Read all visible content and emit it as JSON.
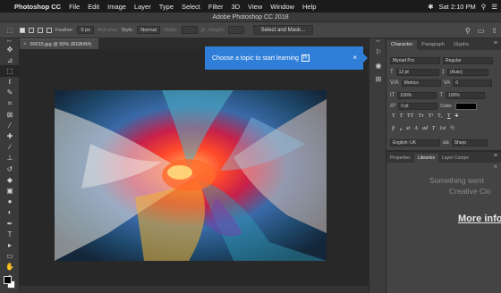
{
  "menubar": {
    "app_name": "Photoshop CC",
    "items": [
      "File",
      "Edit",
      "Image",
      "Layer",
      "Type",
      "Select",
      "Filter",
      "3D",
      "View",
      "Window",
      "Help"
    ],
    "clock": "Sat 2:10 PM"
  },
  "window": {
    "title": "Adobe Photoshop CC 2018"
  },
  "options_bar": {
    "feather_label": "Feather:",
    "feather_value": "0 px",
    "anti_alias_label": "Anti-alias",
    "style_label": "Style:",
    "style_value": "Normal",
    "width_label": "Width:",
    "height_label": "Height:",
    "select_mask_label": "Select and Mask..."
  },
  "document": {
    "tab_label": "00015.jpg @ 50% (RGB/8#)",
    "close_glyph": "×"
  },
  "learn_tooltip": {
    "text": "Choose a topic to start learning",
    "badge": "Pr",
    "close_glyph": "×"
  },
  "character_panel": {
    "tabs": [
      "Character",
      "Paragraph",
      "Glyphs"
    ],
    "font_family": "Myriad Pro",
    "font_style": "Regular",
    "font_size": "12 pt",
    "leading": "(Auto)",
    "kerning": "Metrics",
    "tracking": "0",
    "vertical_scale": "100%",
    "horizontal_scale": "100%",
    "baseline_shift": "0 pt",
    "color_label": "Color:",
    "type_styles": [
      "T",
      "T",
      "TT",
      "Tт",
      "T¹",
      "T₁",
      "T",
      "T"
    ],
    "opentype": [
      "fi",
      "ℴ",
      "st",
      "A",
      "ad",
      "T",
      "1st",
      "½"
    ],
    "language": "English: UK",
    "antialias": "Sharp",
    "antialias_icon": "aa"
  },
  "lower_panel": {
    "tabs": [
      "Properties",
      "Libraries",
      "Layer Comps"
    ],
    "message_line1": "Something went",
    "message_line2": "Creative Clo",
    "more_info": "More info"
  },
  "colors": {
    "tooltip_bg": "#2f7ed8",
    "panel_bg": "#444444",
    "canvas_bg": "#282828"
  }
}
